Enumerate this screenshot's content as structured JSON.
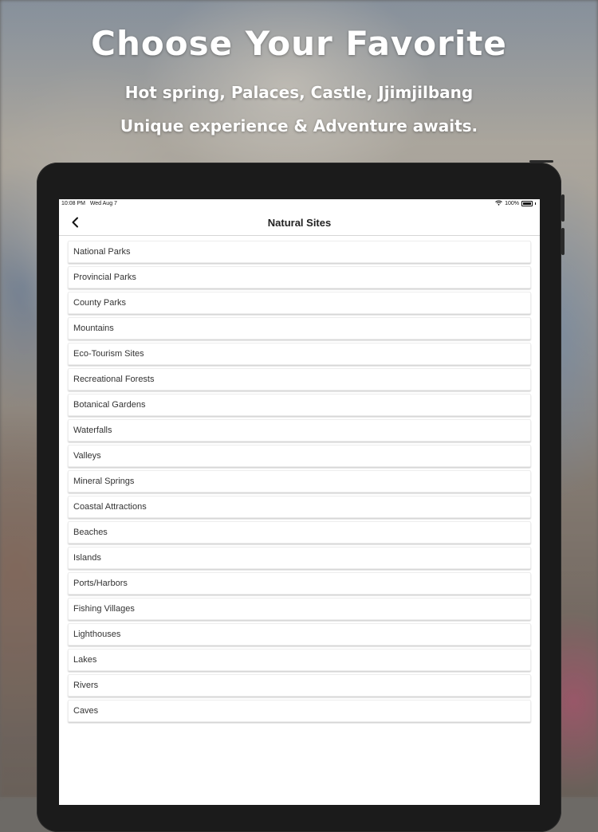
{
  "promo": {
    "headline": "Choose Your Favorite",
    "subline1": "Hot spring, Palaces, Castle, Jjimjilbang",
    "subline2": "Unique experience & Adventure awaits."
  },
  "status_bar": {
    "time": "10:08 PM",
    "date": "Wed Aug 7",
    "battery": "100%",
    "wifi_icon": "wifi-icon",
    "battery_icon": "battery-icon"
  },
  "nav": {
    "title": "Natural Sites",
    "back_icon": "chevron-left-icon"
  },
  "list_items": [
    "National Parks",
    "Provincial Parks",
    "County Parks",
    "Mountains",
    "Eco-Tourism Sites",
    "Recreational Forests",
    "Botanical Gardens",
    "Waterfalls",
    "Valleys",
    "Mineral Springs",
    "Coastal Attractions",
    "Beaches",
    "Islands",
    "Ports/Harbors",
    "Fishing Villages",
    "Lighthouses",
    "Lakes",
    "Rivers",
    "Caves"
  ]
}
